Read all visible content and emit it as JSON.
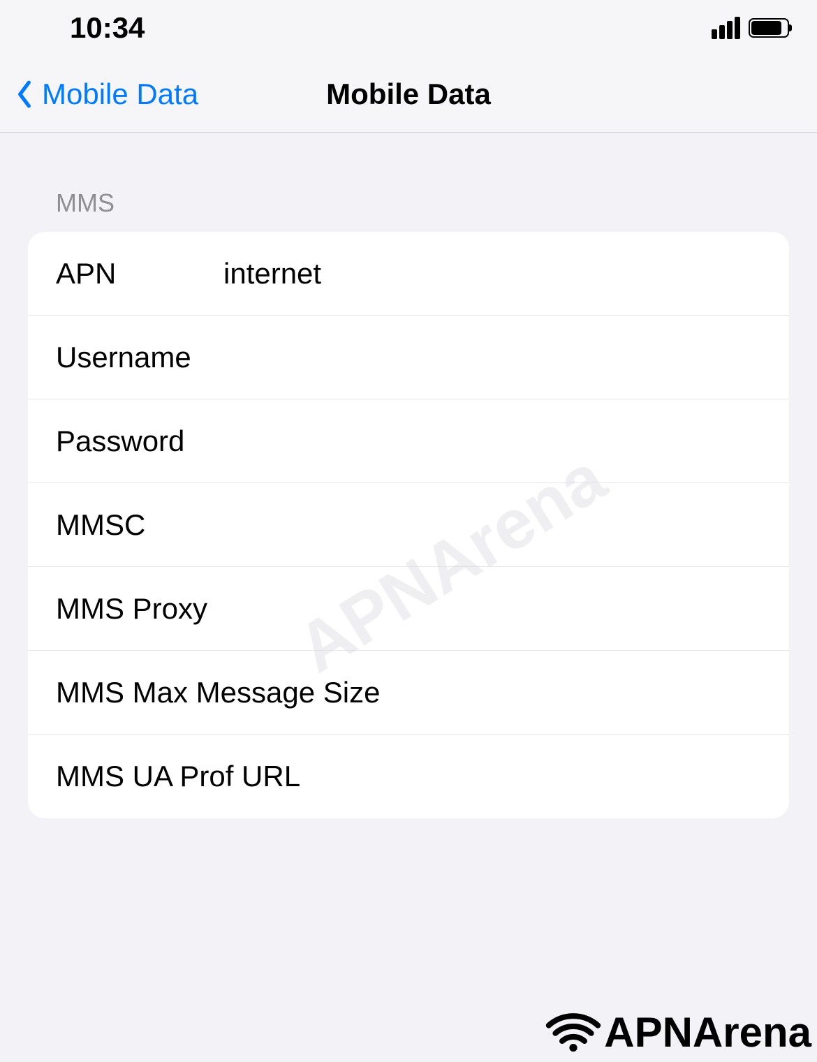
{
  "status": {
    "time": "10:34"
  },
  "nav": {
    "back_label": "Mobile Data",
    "title": "Mobile Data"
  },
  "section": {
    "header": "MMS"
  },
  "fields": {
    "apn": {
      "label": "APN",
      "value": "internet"
    },
    "username": {
      "label": "Username",
      "value": ""
    },
    "password": {
      "label": "Password",
      "value": ""
    },
    "mmsc": {
      "label": "MMSC",
      "value": ""
    },
    "mms_proxy": {
      "label": "MMS Proxy",
      "value": ""
    },
    "mms_max": {
      "label": "MMS Max Message Size",
      "value": ""
    },
    "mms_ua": {
      "label": "MMS UA Prof URL",
      "value": ""
    }
  },
  "watermark": {
    "text": "APNArena"
  },
  "branding": {
    "text": "APNArena"
  }
}
